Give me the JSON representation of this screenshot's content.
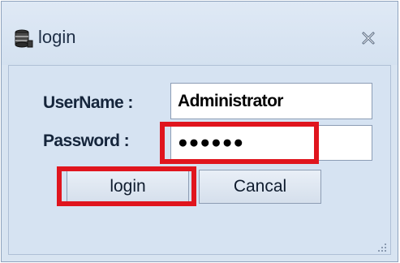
{
  "window": {
    "title": "login",
    "icon": "database-icon",
    "close_icon": "close-icon"
  },
  "form": {
    "username_label": "UserName :",
    "username_value": "Administrator",
    "password_label": "Password :",
    "password_value": "●●●●●●"
  },
  "buttons": {
    "login_label": "login",
    "cancel_label": "Cancal"
  },
  "colors": {
    "highlight": "#e0151e",
    "window_bg": "#d8e4f1"
  }
}
